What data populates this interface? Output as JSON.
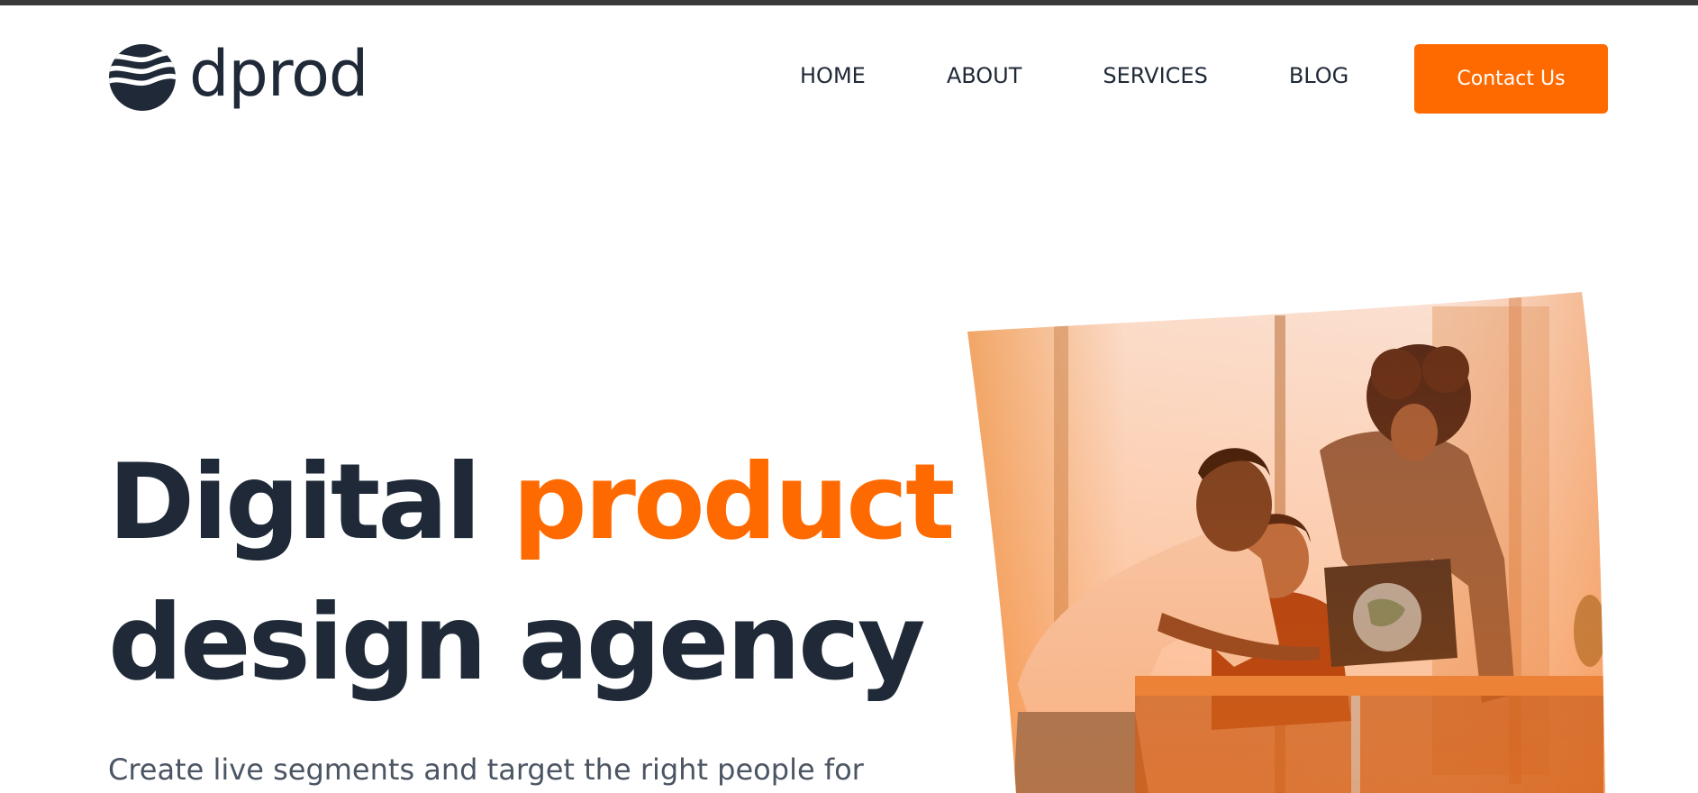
{
  "brand": {
    "name": "dprod",
    "logo_icon": "waves-globe-icon",
    "accent_color": "#ff6a00",
    "text_color": "#1f2937"
  },
  "nav": {
    "items": [
      {
        "label": "HOME"
      },
      {
        "label": "ABOUT"
      },
      {
        "label": "SERVICES"
      },
      {
        "label": "BLOG"
      }
    ],
    "cta_label": "Contact Us"
  },
  "hero": {
    "title_part1": "Digital ",
    "title_accent": "product",
    "title_line2": "design agency",
    "subtitle": "Create live segments and target the right people for",
    "image_alt": "team-working-at-laptop-photo"
  }
}
